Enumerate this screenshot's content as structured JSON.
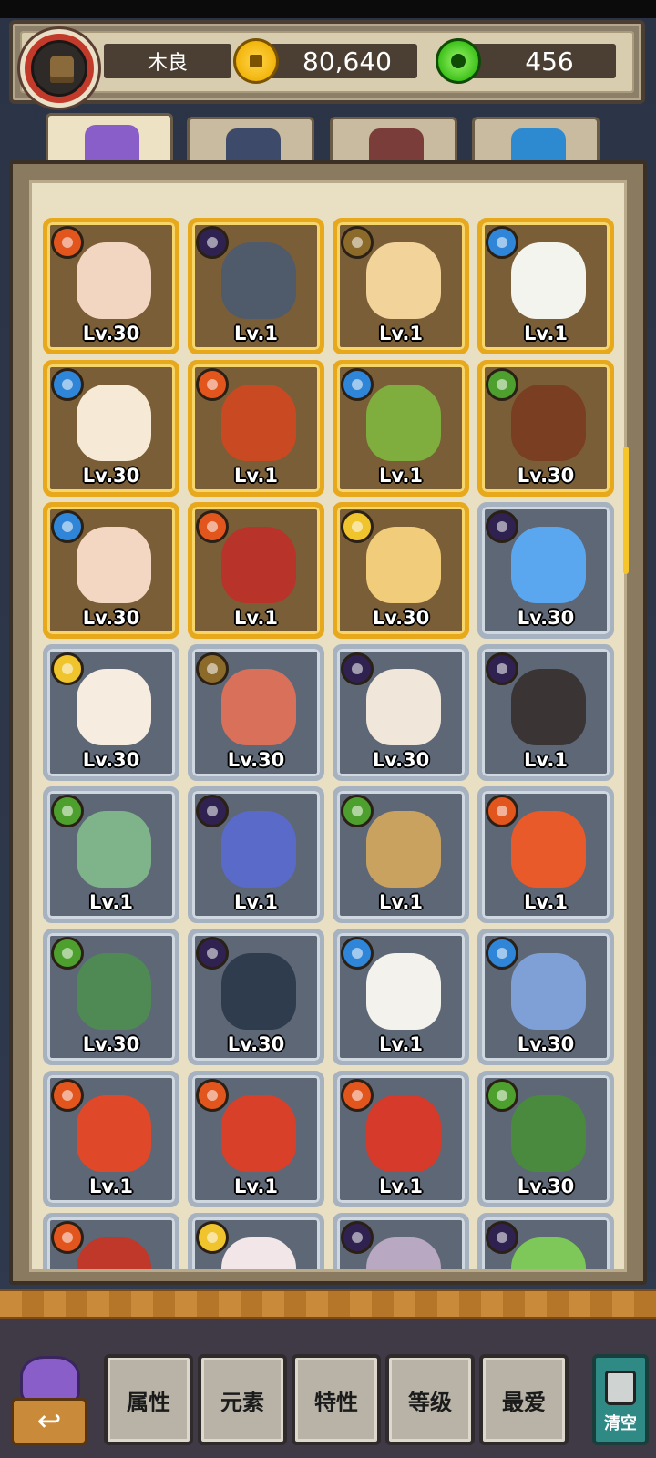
{
  "header": {
    "player_name": "木良",
    "coins": "80,640",
    "gems": "456"
  },
  "tabs": [
    {
      "name": "characters",
      "icon": "purple-monster-icon",
      "active": true
    },
    {
      "name": "relics",
      "icon": "peacock-eye-icon",
      "active": false
    },
    {
      "name": "food",
      "icon": "noodle-bowl-icon",
      "active": false
    },
    {
      "name": "crystals",
      "icon": "blue-crystal-icon",
      "active": false
    }
  ],
  "cards": [
    {
      "element": "fire",
      "level": "Lv.30",
      "frame": "gold",
      "color": "#f2d6c2"
    },
    {
      "element": "dark",
      "level": "Lv.1",
      "frame": "gold",
      "color": "#4f5a6a"
    },
    {
      "element": "earth",
      "level": "Lv.1",
      "frame": "gold",
      "color": "#f2d49a"
    },
    {
      "element": "water",
      "level": "Lv.1",
      "frame": "gold",
      "color": "#f4f4ee"
    },
    {
      "element": "water",
      "level": "Lv.30",
      "frame": "gold",
      "color": "#f6ead6"
    },
    {
      "element": "fire",
      "level": "Lv.1",
      "frame": "gold",
      "color": "#c94a22"
    },
    {
      "element": "water",
      "level": "Lv.1",
      "frame": "gold",
      "color": "#7fae3e"
    },
    {
      "element": "wood",
      "level": "Lv.30",
      "frame": "gold",
      "color": "#7a3e22"
    },
    {
      "element": "water",
      "level": "Lv.30",
      "frame": "gold",
      "color": "#f3d7c3"
    },
    {
      "element": "fire",
      "level": "Lv.1",
      "frame": "gold",
      "color": "#b8342a"
    },
    {
      "element": "light",
      "level": "Lv.30",
      "frame": "gold",
      "color": "#f1cc7a"
    },
    {
      "element": "dark",
      "level": "Lv.30",
      "frame": "blue",
      "color": "#5aa7f0"
    },
    {
      "element": "light",
      "level": "Lv.30",
      "frame": "blue",
      "color": "#f6ece0"
    },
    {
      "element": "earth",
      "level": "Lv.30",
      "frame": "blue",
      "color": "#d9705a"
    },
    {
      "element": "dark",
      "level": "Lv.30",
      "frame": "blue",
      "color": "#f0e6da"
    },
    {
      "element": "dark",
      "level": "Lv.1",
      "frame": "blue",
      "color": "#3a3434"
    },
    {
      "element": "wood",
      "level": "Lv.1",
      "frame": "blue",
      "color": "#7fb38a"
    },
    {
      "element": "dark",
      "level": "Lv.1",
      "frame": "blue",
      "color": "#5a6ac8"
    },
    {
      "element": "wood",
      "level": "Lv.1",
      "frame": "blue",
      "color": "#c9a260"
    },
    {
      "element": "fire",
      "level": "Lv.1",
      "frame": "blue",
      "color": "#e85a2a"
    },
    {
      "element": "wood",
      "level": "Lv.30",
      "frame": "blue",
      "color": "#4f8a54"
    },
    {
      "element": "dark",
      "level": "Lv.30",
      "frame": "blue",
      "color": "#2f3c4e"
    },
    {
      "element": "water",
      "level": "Lv.1",
      "frame": "blue",
      "color": "#f4f2ec"
    },
    {
      "element": "water",
      "level": "Lv.30",
      "frame": "blue",
      "color": "#7fa0d6"
    },
    {
      "element": "fire",
      "level": "Lv.1",
      "frame": "blue",
      "color": "#e0482a"
    },
    {
      "element": "fire",
      "level": "Lv.1",
      "frame": "blue",
      "color": "#d8402a"
    },
    {
      "element": "fire",
      "level": "Lv.1",
      "frame": "blue",
      "color": "#d63a2a"
    },
    {
      "element": "wood",
      "level": "Lv.30",
      "frame": "blue",
      "color": "#4a8a3e"
    },
    {
      "element": "fire",
      "level": "",
      "frame": "blue",
      "color": "#c0382a"
    },
    {
      "element": "light",
      "level": "",
      "frame": "blue",
      "color": "#f2e6e8"
    },
    {
      "element": "dark",
      "level": "",
      "frame": "blue",
      "color": "#b9a8c2"
    },
    {
      "element": "dark",
      "level": "",
      "frame": "blue",
      "color": "#7ec85a"
    }
  ],
  "footer": {
    "back_icon": "return-arrow-icon",
    "filters": [
      "属性",
      "元素",
      "特性",
      "等级",
      "最爱"
    ],
    "clear_label": "清空"
  },
  "colors": {
    "gold_frame": "#e8a81c",
    "blue_frame": "#a7b2c1",
    "panel_bg": "#e9dfc3"
  }
}
